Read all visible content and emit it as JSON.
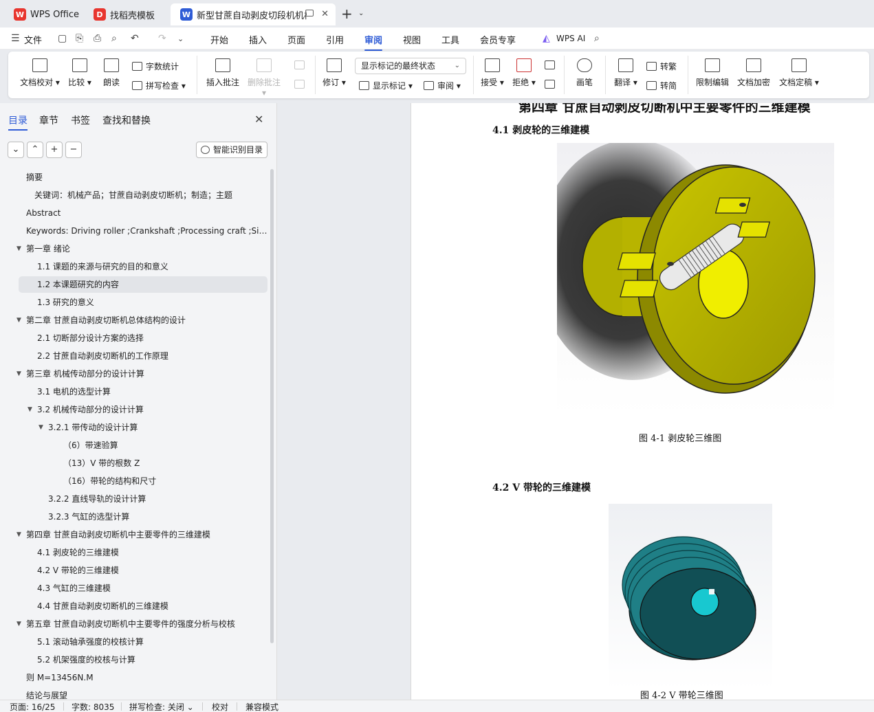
{
  "tabs": [
    {
      "label": "WPS Office",
      "logo": "W"
    },
    {
      "label": "找稻壳模板",
      "logo": "D"
    },
    {
      "label": "新型甘蔗自动剥皮切段机机械",
      "logo": "W"
    }
  ],
  "menubar": {
    "file": "文件",
    "items": [
      "开始",
      "插入",
      "页面",
      "引用",
      "审阅",
      "视图",
      "工具",
      "会员专享"
    ],
    "active": "审阅",
    "wps_ai": "WPS AI"
  },
  "ribbon": {
    "doc_check": "文档校对",
    "compare": "比较",
    "read_aloud": "朗读",
    "word_count": "字数统计",
    "spell_check": "拼写检查",
    "insert_comment": "插入批注",
    "delete_comment": "删除批注",
    "track_changes": "修订",
    "markup_state": "显示标记的最终状态",
    "show_markup": "显示标记",
    "review": "审阅",
    "accept": "接受",
    "reject": "拒绝",
    "pen": "画笔",
    "translate": "翻译",
    "to_traditional": "转繁",
    "to_simplified": "转简",
    "restrict_edit": "限制编辑",
    "doc_encrypt": "文档加密",
    "doc_finalize": "文档定稿"
  },
  "leftpanel": {
    "tabs": [
      "目录",
      "章节",
      "书签",
      "查找和替换"
    ],
    "smart_toc": "智能识别目录",
    "toc": [
      {
        "text": "摘要",
        "level": 0,
        "arrow": false
      },
      {
        "text": "关键词：机械产品；甘蔗自动剥皮切断机；制造；主题",
        "level": 0.5,
        "arrow": false
      },
      {
        "text": "Abstract",
        "level": 0,
        "arrow": false
      },
      {
        "text": "Keywords: Driving roller ;Crankshaft ;Processing craft ;Si ...",
        "level": 0,
        "arrow": false
      },
      {
        "text": "第一章  绪论",
        "level": 0,
        "arrow": true
      },
      {
        "text": "1.1  课题的来源与研究的目的和意义",
        "level": 1,
        "arrow": false
      },
      {
        "text": "1.2  本课题研究的内容",
        "level": 1,
        "arrow": false,
        "selected": true
      },
      {
        "text": "1.3  研究的意义",
        "level": 1,
        "arrow": false
      },
      {
        "text": "第二章  甘蔗自动剥皮切断机总体结构的设计",
        "level": 0,
        "arrow": true
      },
      {
        "text": "2.1 切断部分设计方案的选择",
        "level": 1,
        "arrow": false
      },
      {
        "text": "2.2 甘蔗自动剥皮切断机的工作原理",
        "level": 1,
        "arrow": false
      },
      {
        "text": "第三章  机械传动部分的设计计算",
        "level": 0,
        "arrow": true
      },
      {
        "text": "3.1 电机的选型计算",
        "level": 1,
        "arrow": false
      },
      {
        "text": "3.2  机械传动部分的设计计算",
        "level": 1,
        "arrow": true
      },
      {
        "text": "3.2.1  带传动的设计计算",
        "level": 2,
        "arrow": true
      },
      {
        "text": "（6）带速验算",
        "level": 3,
        "arrow": false
      },
      {
        "text": "（13）V 带的根数 Z",
        "level": 3,
        "arrow": false
      },
      {
        "text": "（16）带轮的结构和尺寸",
        "level": 3,
        "arrow": false
      },
      {
        "text": "3.2.2 直线导轨的设计计算",
        "level": 2,
        "arrow": false
      },
      {
        "text": "3.2.3  气缸的选型计算",
        "level": 2,
        "arrow": false
      },
      {
        "text": "第四章  甘蔗自动剥皮切断机中主要零件的三维建模",
        "level": 0,
        "arrow": true
      },
      {
        "text": "4.1 剥皮轮的三维建模",
        "level": 1,
        "arrow": false
      },
      {
        "text": "4.2 V 带轮的三维建模",
        "level": 1,
        "arrow": false
      },
      {
        "text": "4.3 气缸的三维建模",
        "level": 1,
        "arrow": false
      },
      {
        "text": "4.4 甘蔗自动剥皮切断机的三维建模",
        "level": 1,
        "arrow": false
      },
      {
        "text": "第五章  甘蔗自动剥皮切断机中主要零件的强度分析与校核",
        "level": 0,
        "arrow": true
      },
      {
        "text": "5.1 滚动轴承强度的校核计算",
        "level": 1,
        "arrow": false
      },
      {
        "text": "5.2 机架强度的校核与计算",
        "level": 1,
        "arrow": false
      },
      {
        "text": "则 M=13456N.M",
        "level": 0,
        "arrow": false
      },
      {
        "text": "结论与展望",
        "level": 0,
        "arrow": false
      }
    ]
  },
  "document": {
    "chapter_title": "第四章  甘蔗自动剥皮切断机中主要零件的三维建模",
    "section1": "4.1 剥皮轮的三维建模",
    "caption1": "图 4-1  剥皮轮三维图",
    "section2": "4.2 V 带轮的三维建模",
    "caption2": "图 4-2  V 带轮三维图"
  },
  "statusbar": {
    "page": "页面: 16/25",
    "words": "字数: 8035",
    "spell": "拼写检查: 关闭",
    "proof": "校对",
    "compat": "兼容模式"
  },
  "colors": {
    "accent": "#2f5cd6",
    "peel_wheel": "#d9d400",
    "pulley": "#1f7f86",
    "wps_red": "#e8352e"
  }
}
